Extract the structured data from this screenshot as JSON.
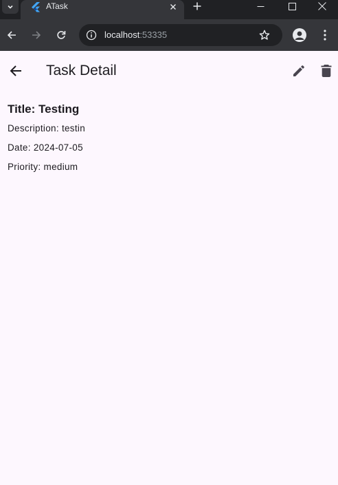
{
  "browser": {
    "tab_title": "ATask",
    "url_host": "localhost",
    "url_port": ":53335",
    "colors": {
      "frame": "#202124",
      "toolbar": "#35363a",
      "text": "#e8eaed"
    }
  },
  "app": {
    "title": "Task Detail",
    "background": "#fdf7fe",
    "icons": {
      "back": "arrow-back-icon",
      "edit": "pencil-icon",
      "delete": "trash-icon"
    }
  },
  "task": {
    "title_label": "Title:",
    "title_value": "Testing",
    "description_label": "Description:",
    "description_value": "testin",
    "date_label": "Date:",
    "date_value": "2024-07-05",
    "priority_label": "Priority:",
    "priority_value": "medium"
  }
}
